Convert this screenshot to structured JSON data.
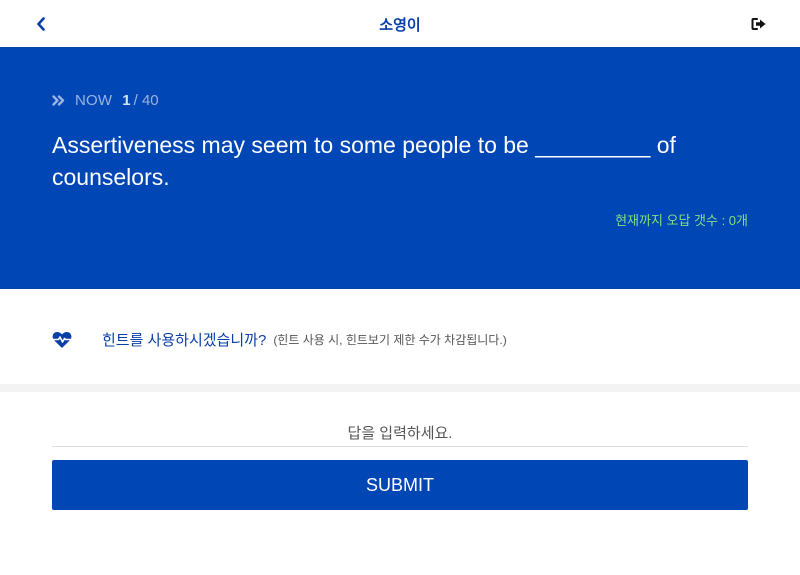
{
  "header": {
    "title": "소영이",
    "back_icon": "chevron-left-icon",
    "exit_icon": "sign-out-icon"
  },
  "question": {
    "now_label": "NOW",
    "current": "1",
    "total": "/ 40",
    "text": "Assertiveness may seem to some people to be _________ of counselors.",
    "wrong_count": "현재까지 오답 갯수 : 0개"
  },
  "hint": {
    "icon": "heartbeat-icon",
    "label": "힌트를 사용하시겠습니까?",
    "note": "(힌트 사용 시, 힌트보기 제한 수가 차감됩니다.)"
  },
  "answer": {
    "placeholder": "답을 입력하세요.",
    "value": ""
  },
  "submit": {
    "label": "SUBMIT"
  },
  "colors": {
    "brand": "#0046b5",
    "title": "#0a3fa8",
    "wrong_count": "#86e07f"
  }
}
